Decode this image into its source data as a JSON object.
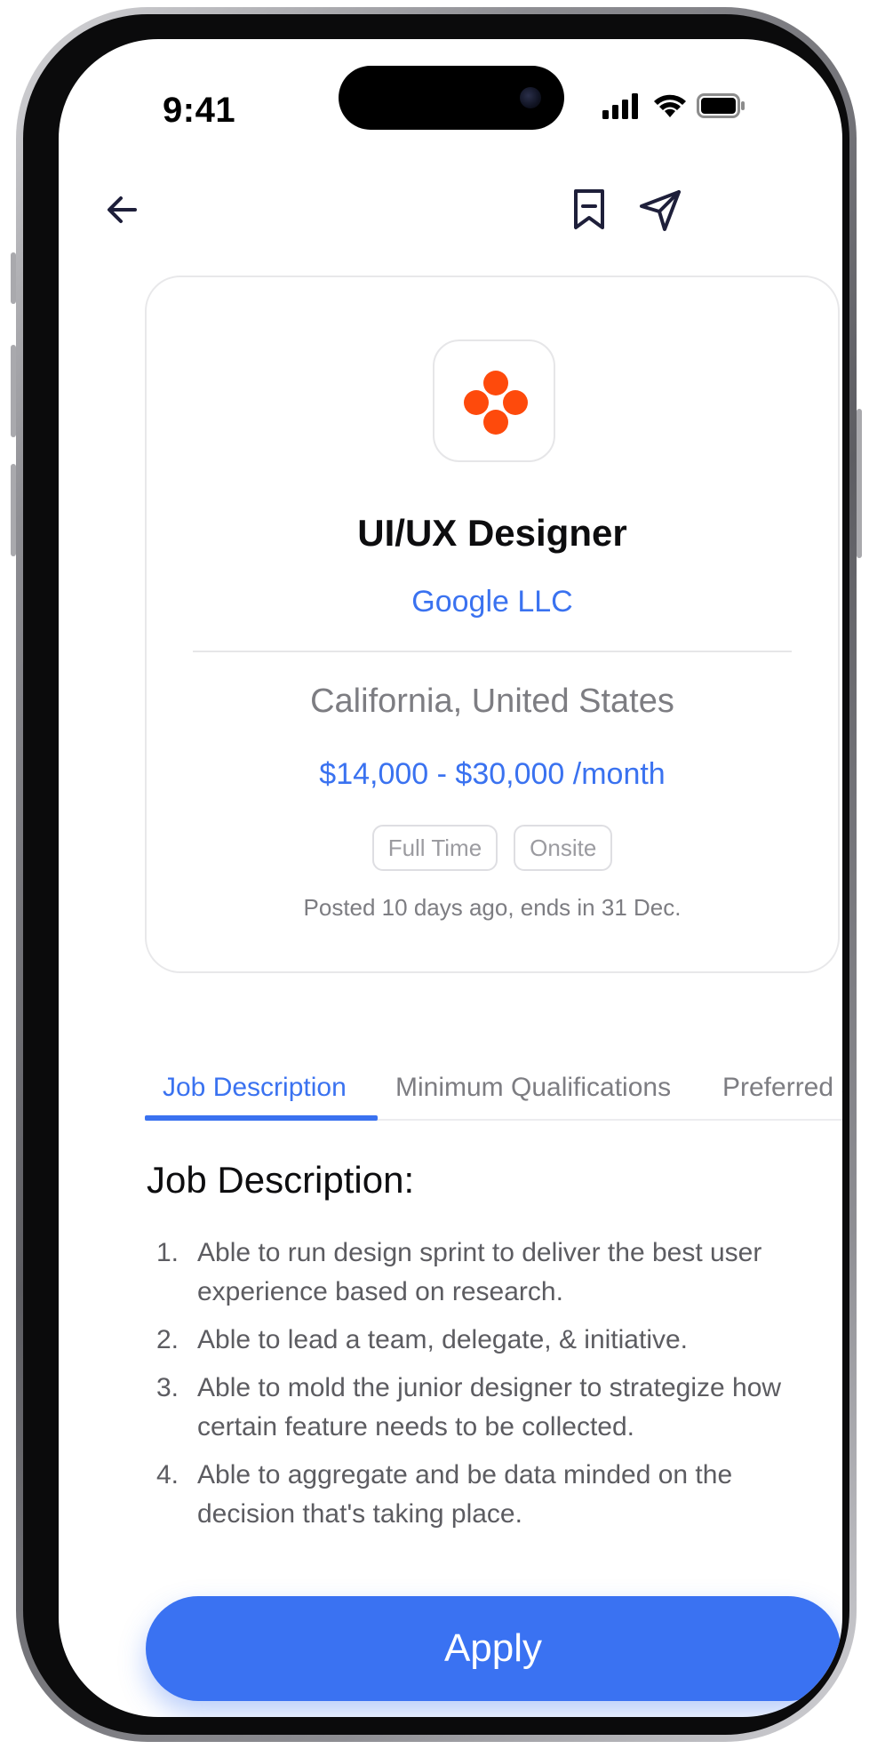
{
  "status_bar": {
    "time": "9:41",
    "icons": [
      "cellular-signal-icon",
      "wifi-icon",
      "battery-icon"
    ]
  },
  "nav": {
    "back_icon": "arrow-left-icon",
    "bookmark_icon": "bookmark-icon",
    "share_icon": "send-icon"
  },
  "job": {
    "title": "UI/UX Designer",
    "company": "Google LLC",
    "location": "California, United States",
    "salary": "$14,000 - $30,000 /month",
    "tags": [
      "Full Time",
      "Onsite"
    ],
    "posted": "Posted 10 days ago, ends in 31 Dec.",
    "logo_color": "#fe4a0c"
  },
  "tabs": [
    {
      "label": "Job Description",
      "active": true
    },
    {
      "label": "Minimum Qualifications",
      "active": false
    },
    {
      "label": "Preferred Skills",
      "active": false
    }
  ],
  "description": {
    "heading": "Job Description:",
    "items": [
      {
        "num": "1.",
        "text": "Able to run design sprint to deliver the best user experience based on research."
      },
      {
        "num": "2.",
        "text": "Able to lead a team, delegate, & initiative."
      },
      {
        "num": "3.",
        "text": "Able to mold the junior designer to strategize how certain feature needs to be collected."
      },
      {
        "num": "4.",
        "text": "Able to aggregate and be data minded on the decision that's taking place."
      }
    ]
  },
  "apply_label": "Apply",
  "colors": {
    "accent": "#3a72f0",
    "text_primary": "#0d0d0f",
    "text_secondary": "#7d7d82"
  }
}
